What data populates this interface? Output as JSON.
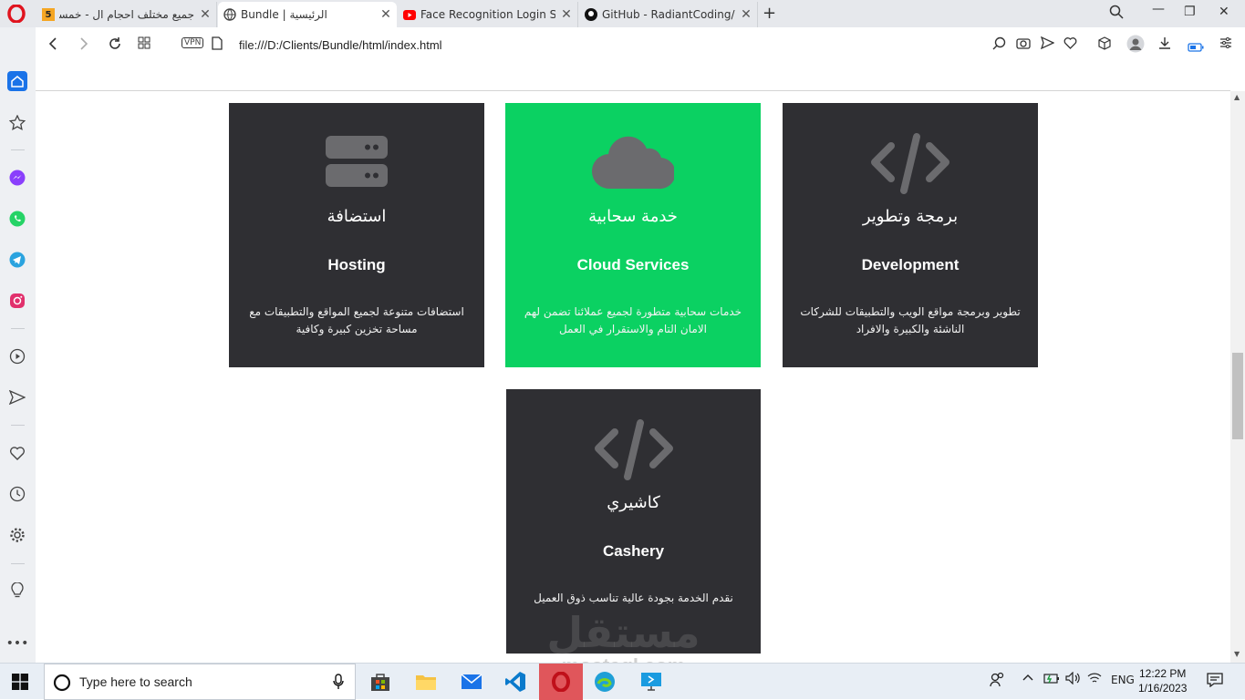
{
  "browser": {
    "tabs": [
      {
        "title": "جميع مختلف احجام ال - خمسات",
        "favicon": "khamsat-icon",
        "badge": "5",
        "active": false
      },
      {
        "title": "Bundle | الرئيسية",
        "favicon": "globe-icon",
        "active": true
      },
      {
        "title": "Face Recognition Login Sys",
        "favicon": "youtube-icon",
        "active": false
      },
      {
        "title": "GitHub - RadiantCoding/Co",
        "favicon": "github-icon",
        "active": false
      }
    ],
    "vpn_label": "VPN",
    "url": "file:///D:/Clients/Bundle/html/index.html"
  },
  "services": [
    {
      "icon": "server-icon",
      "title_ar": "استضافة",
      "title_en": "Hosting",
      "desc": "استضافات متنوعة لجميع المواقع والتطبيقات مع مساحة تخزين كبيرة وكافية",
      "highlight": false
    },
    {
      "icon": "cloud-icon",
      "title_ar": "خدمة سحابية",
      "title_en": "Cloud Services",
      "desc": "خدمات سحابية متطورة لجميع عملائنا تضمن لهم الامان التام والاستقرار في العمل",
      "highlight": true
    },
    {
      "icon": "code-icon",
      "title_ar": "برمجة وتطوير",
      "title_en": "Development",
      "desc": "تطوير وبرمجة مواقع الويب والتطبيقات للشركات الناشئة والكبيرة والافراد",
      "highlight": false
    },
    {
      "icon": "code-icon",
      "title_ar": "كاشيري",
      "title_en": "Cashery",
      "desc": "نقدم الخدمة بجودة عالية تناسب ذوق العميل",
      "highlight": false
    }
  ],
  "colors": {
    "card_dark": "#2f2f33",
    "card_green": "#0bd162",
    "icon_gray": "#6b6b6e"
  },
  "taskbar": {
    "search_placeholder": "Type here to search",
    "language": "ENG",
    "time": "12:22 PM",
    "date": "1/16/2023"
  },
  "watermark": {
    "arabic": "مستقل",
    "latin": "mostaql.com"
  }
}
